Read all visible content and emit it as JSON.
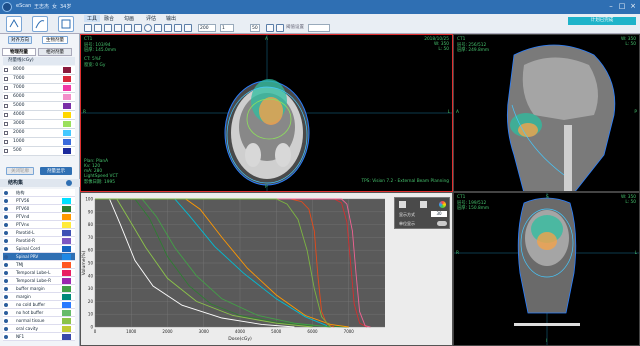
{
  "titlebar": {
    "app": "eScan",
    "patient_name": "王志杰",
    "patient_sex": "女",
    "patient_age": "34岁"
  },
  "menu": {
    "items": [
      "工具",
      "融合",
      "勾画",
      "评估",
      "输出"
    ]
  },
  "toolbar": {
    "field_a": "200",
    "field_b": "1",
    "field_c": "50",
    "thresh_label": "阈值设置",
    "teal_button": "计划已完成"
  },
  "left": {
    "btn_align": "对齐方向",
    "btn_bio": "生物剂量",
    "tab_dose": "物理剂量",
    "tab_rel": "相对剂量",
    "iso_header": "剂量线(cGy)",
    "isodoses": [
      {
        "v": "8000",
        "c": "#8b1a3c"
      },
      {
        "v": "7000",
        "c": "#d9293b"
      },
      {
        "v": "7000",
        "c": "#ef3aa6"
      },
      {
        "v": "6000",
        "c": "#f28fc9"
      },
      {
        "v": "5000",
        "c": "#7b2fa8"
      },
      {
        "v": "4000",
        "c": "#ffd700"
      },
      {
        "v": "3000",
        "c": "#9be05c"
      },
      {
        "v": "2000",
        "c": "#45c9ff"
      },
      {
        "v": "1000",
        "c": "#3a6bdc"
      },
      {
        "v": "500",
        "c": "#1b2a9c"
      }
    ],
    "btn_disabled": "关闭轮廓",
    "btn_show": "剂量显示",
    "struct_header": "结构集",
    "structs": [
      {
        "n": "结构",
        "c": "#ffffff"
      },
      {
        "n": "PTV56",
        "c": "#00e0ff"
      },
      {
        "n": "PTV60",
        "c": "#2e7d32"
      },
      {
        "n": "PTVnd",
        "c": "#ff9800"
      },
      {
        "n": "PTVnx",
        "c": "#ffeb3b"
      },
      {
        "n": "Parotid-L",
        "c": "#3f51b5"
      },
      {
        "n": "Parotid-R",
        "c": "#7e57c2"
      },
      {
        "n": "Spinal Cord",
        "c": "#1565c0"
      },
      {
        "n": "Spinal PRV",
        "c": "#1e88e5"
      },
      {
        "n": "TMJ",
        "c": "#ff5722"
      },
      {
        "n": "Temporal Lobe-L",
        "c": "#e91e63"
      },
      {
        "n": "Temporal Lobe-R",
        "c": "#9c27b0"
      },
      {
        "n": "buffer margin",
        "c": "#43a047"
      },
      {
        "n": "margin",
        "c": "#00897b"
      },
      {
        "n": "no cold buffer",
        "c": "#2979ff"
      },
      {
        "n": "no hot buffer",
        "c": "#66bb6a"
      },
      {
        "n": "normal tissue",
        "c": "#8bc34a"
      },
      {
        "n": "oral cavity",
        "c": "#c0ca33"
      },
      {
        "n": "NF1",
        "c": "#3949ab"
      }
    ]
  },
  "views": {
    "axial": {
      "tl1": "CT1",
      "tl2": "层号: 103/94",
      "tl3": "层厚: 145.0mm",
      "tl4": "CT: 5%F",
      "tl5": "窗宽: 0 Gy",
      "tr1": "2018/10/25",
      "tr2": "W: 350",
      "tr3": "L: 50",
      "bl1": "Plan: PlanA",
      "bl2": "Kv: 120",
      "bl3": "mA: 280",
      "bl4": "LightSpeed VCT",
      "bl5": "影像日期: 1995",
      "br1": "TPS: Vision 7.2 - External Beam Planning",
      "a": "A",
      "p": "P",
      "r": "R",
      "l": "L"
    },
    "sagittal": {
      "tl1": "CT1",
      "tl2": "层号: 256/512",
      "tl3": "层厚: 249.8mm",
      "tr1": "W: 350",
      "tr2": "L: 50",
      "a": "A",
      "p": "P"
    },
    "coronal": {
      "tl1": "CT1",
      "tl2": "层号: 199/512",
      "tl3": "层厚: 150.8mm",
      "tr1": "W: 350",
      "tr2": "L: 50",
      "s": "S",
      "i": "I",
      "r": "R",
      "l": "L"
    }
  },
  "dvh": {
    "panel_title1": "显示方式",
    "panel_val": "30",
    "panel_title2": "单位显示",
    "xlabel": "Dose(cGy)",
    "ylabel": "Volume(%)"
  },
  "chart_data": {
    "type": "line",
    "xlabel": "Dose(cGy)",
    "ylabel": "Volume(%)",
    "xlim": [
      0,
      8000
    ],
    "ylim": [
      0,
      100
    ],
    "x_ticks": [
      0,
      1000,
      2000,
      3000,
      4000,
      5000,
      6000,
      7000
    ],
    "y_ticks": [
      0,
      10,
      20,
      30,
      40,
      50,
      60,
      70,
      80,
      90,
      100
    ],
    "series": [
      {
        "color": "#2e7d32",
        "points": [
          [
            0,
            100
          ],
          [
            1100,
            100
          ],
          [
            1500,
            85
          ],
          [
            2000,
            55
          ],
          [
            2600,
            32
          ],
          [
            3200,
            18
          ],
          [
            4000,
            9
          ],
          [
            5000,
            4
          ],
          [
            6000,
            1
          ],
          [
            7000,
            0
          ]
        ]
      },
      {
        "color": "#43a047",
        "points": [
          [
            0,
            100
          ],
          [
            1300,
            100
          ],
          [
            1700,
            86
          ],
          [
            2200,
            62
          ],
          [
            2800,
            40
          ],
          [
            3500,
            22
          ],
          [
            4500,
            9
          ],
          [
            5500,
            3
          ],
          [
            6500,
            0
          ]
        ]
      },
      {
        "color": "#8bc34a",
        "points": [
          [
            0,
            100
          ],
          [
            600,
            100
          ],
          [
            900,
            86
          ],
          [
            1400,
            62
          ],
          [
            2000,
            38
          ],
          [
            2800,
            20
          ],
          [
            3800,
            9
          ],
          [
            5000,
            3
          ],
          [
            6000,
            0
          ]
        ]
      },
      {
        "color": "#ffffff",
        "points": [
          [
            0,
            100
          ],
          [
            400,
            100
          ],
          [
            700,
            80
          ],
          [
            1100,
            52
          ],
          [
            1600,
            32
          ],
          [
            2400,
            17
          ],
          [
            3500,
            7
          ],
          [
            4600,
            2
          ],
          [
            5500,
            0
          ]
        ]
      },
      {
        "color": "#ff9800",
        "points": [
          [
            0,
            100
          ],
          [
            2500,
            100
          ],
          [
            2900,
            92
          ],
          [
            3500,
            70
          ],
          [
            4200,
            46
          ],
          [
            5000,
            25
          ],
          [
            5800,
            9
          ],
          [
            6500,
            2
          ],
          [
            7000,
            0
          ]
        ]
      },
      {
        "color": "#00bcd4",
        "points": [
          [
            0,
            100
          ],
          [
            2200,
            100
          ],
          [
            2600,
            87
          ],
          [
            3300,
            63
          ],
          [
            4100,
            42
          ],
          [
            5000,
            22
          ],
          [
            5800,
            8
          ],
          [
            6400,
            1
          ]
        ]
      },
      {
        "color": "#e64a19",
        "points": [
          [
            0,
            100
          ],
          [
            5400,
            100
          ],
          [
            5700,
            98
          ],
          [
            5900,
            92
          ],
          [
            6050,
            75
          ],
          [
            6150,
            40
          ],
          [
            6250,
            12
          ],
          [
            6400,
            2
          ],
          [
            6600,
            0
          ]
        ]
      },
      {
        "color": "#d32f2f",
        "points": [
          [
            0,
            100
          ],
          [
            6600,
            100
          ],
          [
            6800,
            97
          ],
          [
            6950,
            82
          ],
          [
            7050,
            50
          ],
          [
            7150,
            18
          ],
          [
            7300,
            3
          ],
          [
            7500,
            0
          ]
        ]
      },
      {
        "color": "#f06292",
        "points": [
          [
            0,
            100
          ],
          [
            6800,
            100
          ],
          [
            6950,
            96
          ],
          [
            7100,
            75
          ],
          [
            7200,
            42
          ],
          [
            7300,
            12
          ],
          [
            7450,
            1
          ],
          [
            7600,
            0
          ]
        ]
      },
      {
        "color": "#7cb342",
        "points": [
          [
            0,
            100
          ],
          [
            5000,
            100
          ],
          [
            5300,
            96
          ],
          [
            5600,
            84
          ],
          [
            5850,
            60
          ],
          [
            6050,
            30
          ],
          [
            6250,
            8
          ],
          [
            6500,
            0
          ]
        ]
      }
    ]
  }
}
